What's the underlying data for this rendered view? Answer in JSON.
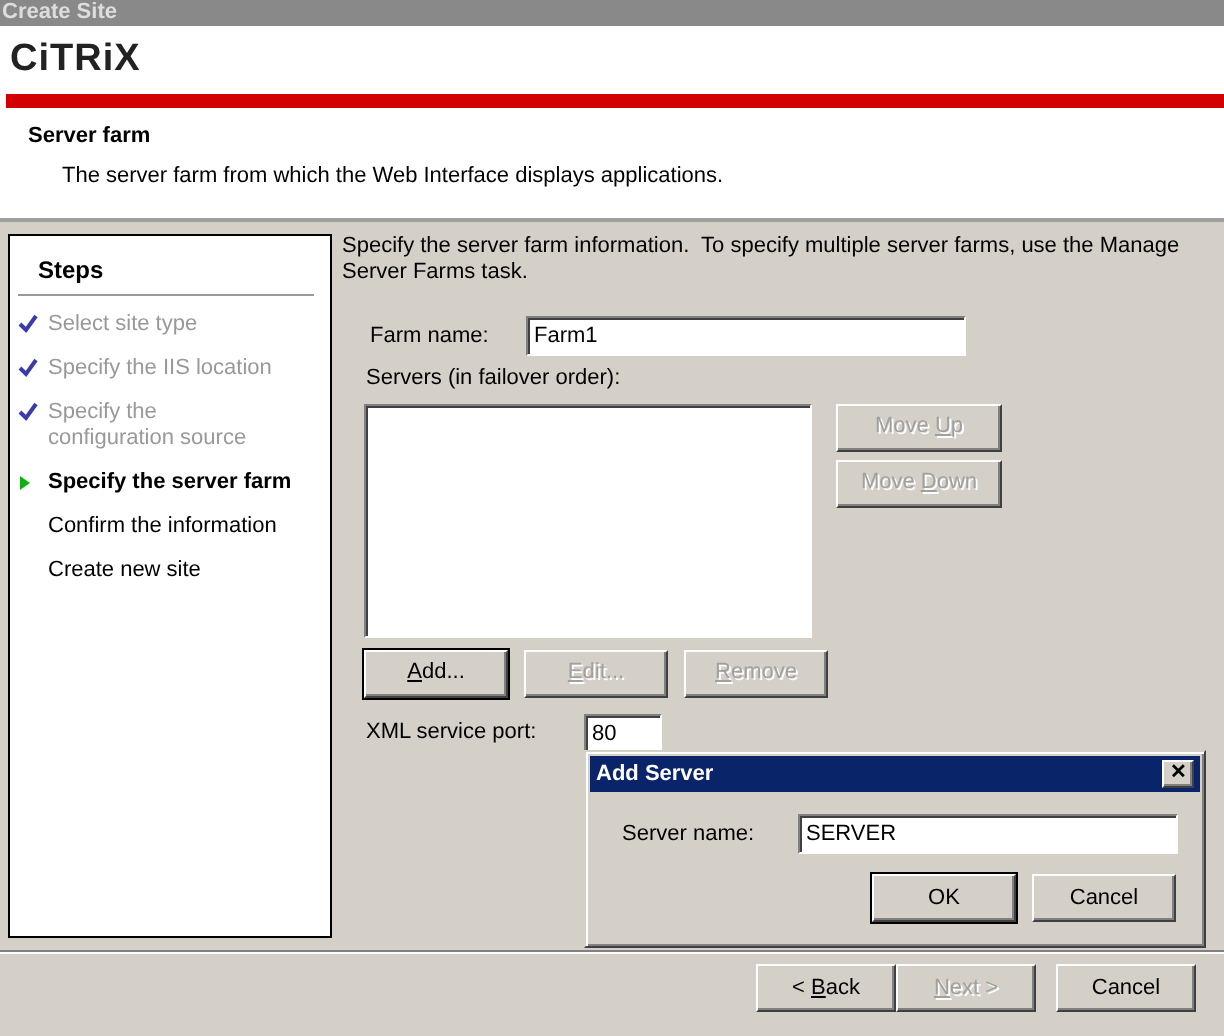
{
  "window": {
    "title": "Create Site"
  },
  "header": {
    "logo": "CiTRiX",
    "title": "Server farm",
    "subtitle": "The server farm from which the Web Interface displays applications."
  },
  "steps": {
    "heading": "Steps",
    "items": [
      {
        "label": "Select site type",
        "done": true,
        "current": false
      },
      {
        "label": "Specify the IIS location",
        "done": true,
        "current": false
      },
      {
        "label": "Specify the configuration source",
        "done": true,
        "current": false
      },
      {
        "label": "Specify the server farm",
        "done": false,
        "current": true
      },
      {
        "label": "Confirm the information",
        "done": false,
        "current": false
      },
      {
        "label": "Create new site",
        "done": false,
        "current": false
      }
    ]
  },
  "content": {
    "intro": "Specify the server farm information.  To specify multiple server farms, use the Manage Server Farms task.",
    "farm_name": {
      "label": "Farm name:",
      "value": "Farm1"
    },
    "servers": {
      "label": "Servers (in failover order):"
    },
    "side_buttons": [
      {
        "before": "Move ",
        "accel": "U",
        "after": "p",
        "disabled": true
      },
      {
        "before": "Move ",
        "accel": "D",
        "after": "own",
        "disabled": true
      }
    ],
    "list_buttons": [
      {
        "accel": "A",
        "after": "dd...",
        "disabled": false,
        "default": true
      },
      {
        "accel": "E",
        "after": "dit...",
        "disabled": true,
        "default": false
      },
      {
        "accel": "R",
        "after": "emove",
        "disabled": true,
        "default": false
      }
    ],
    "port": {
      "label": "XML service port:",
      "value": "80"
    }
  },
  "footer_buttons": [
    {
      "before": "< ",
      "accel": "B",
      "after": "ack",
      "disabled": false
    },
    {
      "accel": "N",
      "after": "ext >",
      "disabled": true
    },
    {
      "before": "Cancel",
      "disabled": false
    }
  ],
  "dialog": {
    "title": "Add Server",
    "close": "✕",
    "field": {
      "label": "Server name:",
      "value": "SERVER"
    },
    "buttons": [
      {
        "before": "OK",
        "default": true
      },
      {
        "before": "Cancel",
        "default": false
      }
    ]
  }
}
